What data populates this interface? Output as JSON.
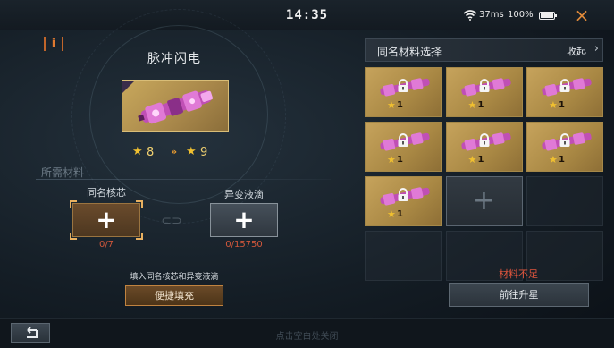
{
  "status_bar": {
    "time": "14:35",
    "ping": "37ms",
    "battery": "100%",
    "battery_level": 1.0,
    "icons": [
      "wifi-icon",
      "battery-icon"
    ]
  },
  "close_icon": "×",
  "info_button": "[i]",
  "item": {
    "name": "脉冲闪电",
    "star_from": "8",
    "star_to": "9"
  },
  "materials": {
    "section_label": "所需材料",
    "core": {
      "label": "同名核芯",
      "count": "0/7"
    },
    "liquid": {
      "label": "异变液滴",
      "count": "0/15750"
    }
  },
  "fill": {
    "hint": "填入同名核芯和异变液滴",
    "button": "便捷填充"
  },
  "selection": {
    "title": "同名材料选择",
    "collapse": "收起",
    "cells": [
      {
        "type": "item",
        "level": "1"
      },
      {
        "type": "item",
        "level": "1"
      },
      {
        "type": "item",
        "level": "1"
      },
      {
        "type": "item",
        "level": "1"
      },
      {
        "type": "item",
        "level": "1"
      },
      {
        "type": "item",
        "level": "1"
      },
      {
        "type": "item",
        "level": "1"
      },
      {
        "type": "empty"
      }
    ]
  },
  "upgrade": {
    "status": "材料不足",
    "button": "前往升星"
  },
  "bottom": {
    "close_hint": "点击空白处关闭"
  },
  "colors": {
    "accent_orange": "#e08a3a",
    "warning_red": "#e0553d",
    "card_gold": "#c6a35c",
    "star_yellow": "#f0c030"
  }
}
